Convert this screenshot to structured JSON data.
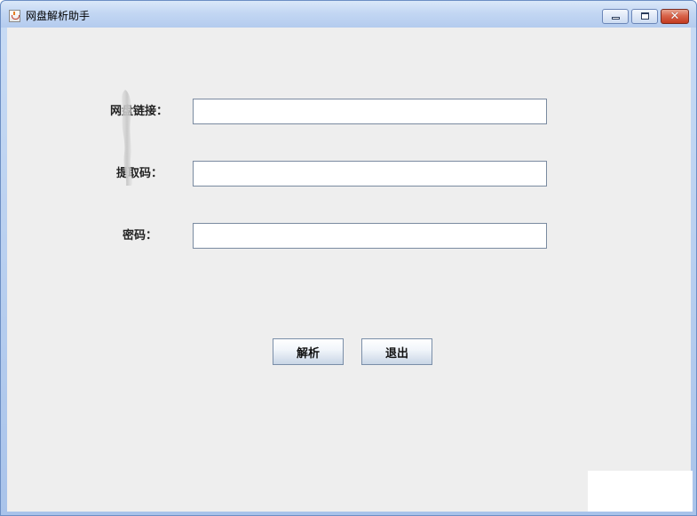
{
  "window": {
    "title": "网盘解析助手",
    "controls": {
      "minimize_icon": "minimize-icon",
      "maximize_icon": "maximize-icon",
      "close_symbol": "✕"
    }
  },
  "form": {
    "fields": [
      {
        "label": "网盘链接：",
        "value": "",
        "placeholder": ""
      },
      {
        "label": "提取码：",
        "value": "",
        "placeholder": ""
      },
      {
        "label": "密码：",
        "value": "",
        "placeholder": ""
      }
    ]
  },
  "buttons": {
    "parse_label": "解析",
    "exit_label": "退出"
  },
  "colors": {
    "titlebar": "#c3d7f3",
    "content_bg": "#eeeeee",
    "close_button": "#c33b20",
    "input_border": "#7a8aa0"
  }
}
